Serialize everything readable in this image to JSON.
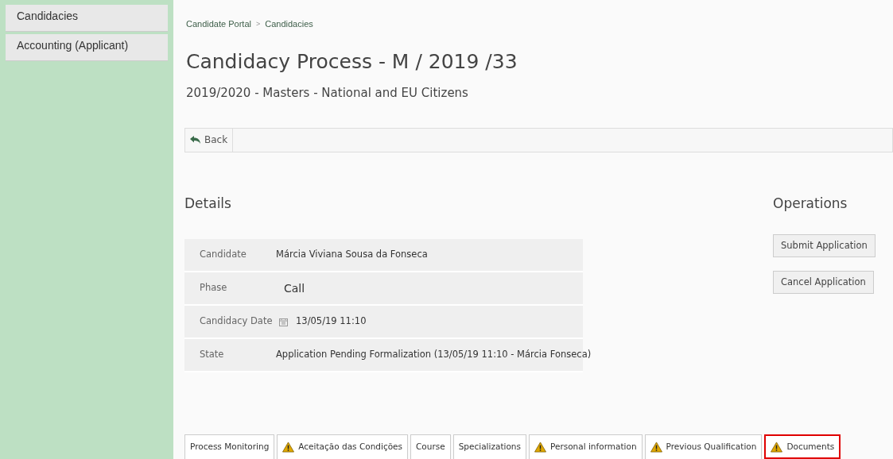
{
  "sidebar": {
    "items": [
      {
        "label": "Candidacies"
      },
      {
        "label": "Accounting (Applicant)"
      }
    ]
  },
  "breadcrumb": [
    "Candidate Portal",
    "Candidacies"
  ],
  "breadcrumb_separator": ">",
  "title": "Candidacy Process - M / 2019 /33",
  "subtitle": "2019/2020 - Masters - National and EU Citizens",
  "back_button": "Back",
  "details": {
    "heading": "Details",
    "rows": [
      {
        "label": "Candidate",
        "value": "Márcia Viviana Sousa da Fonseca",
        "kind": "text"
      },
      {
        "label": "Phase",
        "value": "Call",
        "kind": "large"
      },
      {
        "label": "Candidacy Date",
        "value": "13/05/19 11:10",
        "kind": "date"
      },
      {
        "label": "State",
        "value": "Application Pending Formalization (13/05/19 11:10 - Márcia Fonseca)",
        "kind": "text"
      }
    ]
  },
  "operations": {
    "heading": "Operations",
    "buttons": [
      "Submit Application",
      "Cancel Application"
    ]
  },
  "tabs": [
    {
      "label": "Process Monitoring",
      "warning": false,
      "highlighted": false
    },
    {
      "label": "Aceitação das Condições",
      "warning": true,
      "highlighted": false
    },
    {
      "label": "Course",
      "warning": false,
      "highlighted": false
    },
    {
      "label": "Specializations",
      "warning": false,
      "highlighted": false
    },
    {
      "label": "Personal information",
      "warning": true,
      "highlighted": false
    },
    {
      "label": "Previous Qualification",
      "warning": true,
      "highlighted": false
    },
    {
      "label": "Documents",
      "warning": true,
      "highlighted": true
    }
  ]
}
